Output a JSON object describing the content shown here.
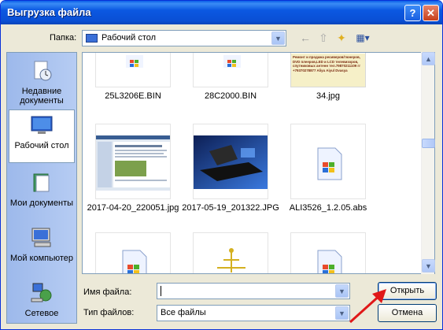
{
  "window": {
    "title": "Выгрузка файла",
    "help_glyph": "?",
    "close_glyph": "✕"
  },
  "toolbar": {
    "folder_label": "Папка:",
    "folder_value": "Рабочий стол",
    "back_glyph": "←",
    "up_glyph": "⇧",
    "new_folder_glyph": "✦",
    "views_glyph": "▦▾"
  },
  "places": [
    {
      "label": "Недавние документы",
      "icon": "recent-documents-icon"
    },
    {
      "label": "Рабочий стол",
      "icon": "desktop-icon"
    },
    {
      "label": "Мои документы",
      "icon": "my-documents-icon"
    },
    {
      "label": "Мой компьютер",
      "icon": "my-computer-icon"
    },
    {
      "label": "Сетевое",
      "icon": "network-icon"
    }
  ],
  "files": [
    {
      "name": "25L3206E.BIN",
      "kind": "windows-file"
    },
    {
      "name": "28C2000.BIN",
      "kind": "windows-file"
    },
    {
      "name": "34.jpg",
      "kind": "image",
      "caption_lines": [
        "Ремонт и продажа ресиверов/тюнеров,",
        "DVD плееров,LED и LCD телевизоров,",
        "спутниковых антенн тел.79870211109 гг",
        "+79370278877 Aliyu Aiyul Dvasya"
      ]
    },
    {
      "name": "2017-04-20_220051.jpg",
      "kind": "screenshot"
    },
    {
      "name": "2017-05-19_201322.JPG",
      "kind": "photo"
    },
    {
      "name": "ALI3526_1.2.05.abs",
      "kind": "windows-file"
    },
    {
      "name": "",
      "kind": "windows-file"
    },
    {
      "name": "",
      "kind": "tool-file"
    },
    {
      "name": "",
      "kind": "windows-file"
    }
  ],
  "form": {
    "filename_label": "Имя файла:",
    "filename_value": "",
    "filetype_label": "Тип файлов:",
    "filetype_value": "Все файлы",
    "open_button": "Открыть",
    "cancel_button": "Отмена"
  },
  "colors": {
    "titlebar": "#0a5ee8",
    "annotation_arrow": "#e01818",
    "dialog_bg": "#ece9d8"
  }
}
